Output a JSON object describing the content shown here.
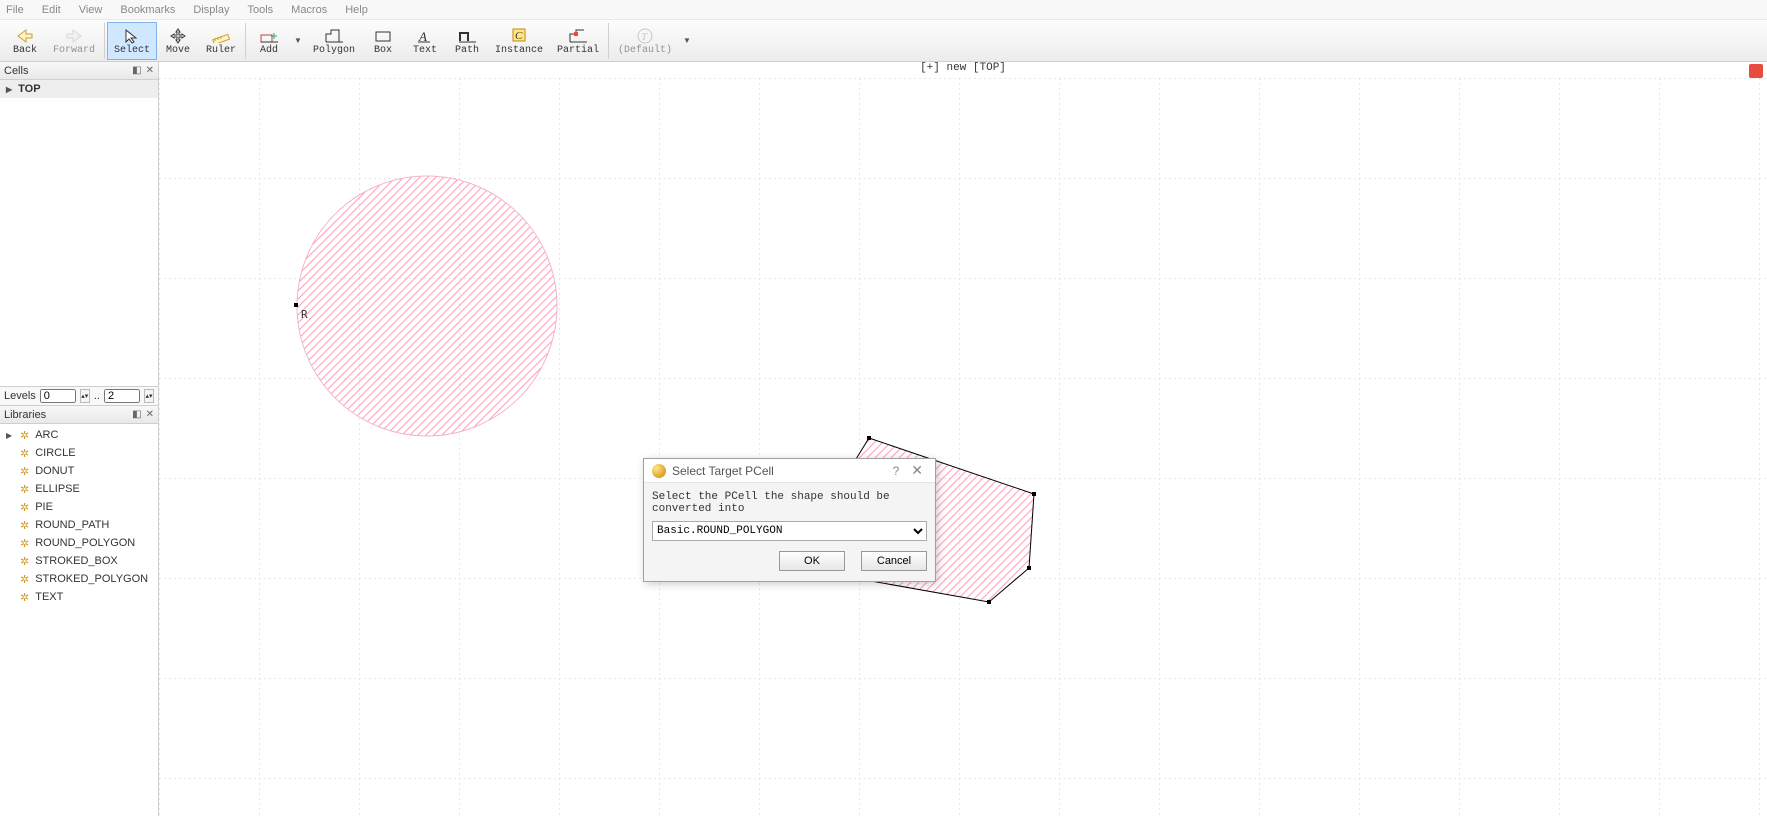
{
  "menu": {
    "items": [
      "File",
      "Edit",
      "View",
      "Bookmarks",
      "Display",
      "Tools",
      "Macros",
      "Help"
    ]
  },
  "toolbar": {
    "back": "Back",
    "forward": "Forward",
    "select": "Select",
    "move": "Move",
    "ruler": "Ruler",
    "add": "Add",
    "polygon": "Polygon",
    "box": "Box",
    "text": "Text",
    "path": "Path",
    "instance": "Instance",
    "partial": "Partial",
    "default": "(Default)"
  },
  "panels": {
    "cells_title": "Cells",
    "libraries_title": "Libraries",
    "cells": [
      {
        "label": "TOP"
      }
    ],
    "levels": {
      "label": "Levels",
      "from": "0",
      "separator": "..",
      "to": "2"
    },
    "libraries": [
      {
        "label": "ARC"
      },
      {
        "label": "CIRCLE"
      },
      {
        "label": "DONUT"
      },
      {
        "label": "ELLIPSE"
      },
      {
        "label": "PIE"
      },
      {
        "label": "ROUND_PATH"
      },
      {
        "label": "ROUND_POLYGON"
      },
      {
        "label": "STROKED_BOX"
      },
      {
        "label": "STROKED_POLYGON"
      },
      {
        "label": "TEXT"
      }
    ]
  },
  "canvas": {
    "title": "[+] new [TOP]",
    "marker_label": "R"
  },
  "dialog": {
    "title": "Select Target PCell",
    "message": "Select the PCell the shape should be converted into",
    "selected": "Basic.ROUND_POLYGON",
    "ok": "OK",
    "cancel": "Cancel"
  }
}
